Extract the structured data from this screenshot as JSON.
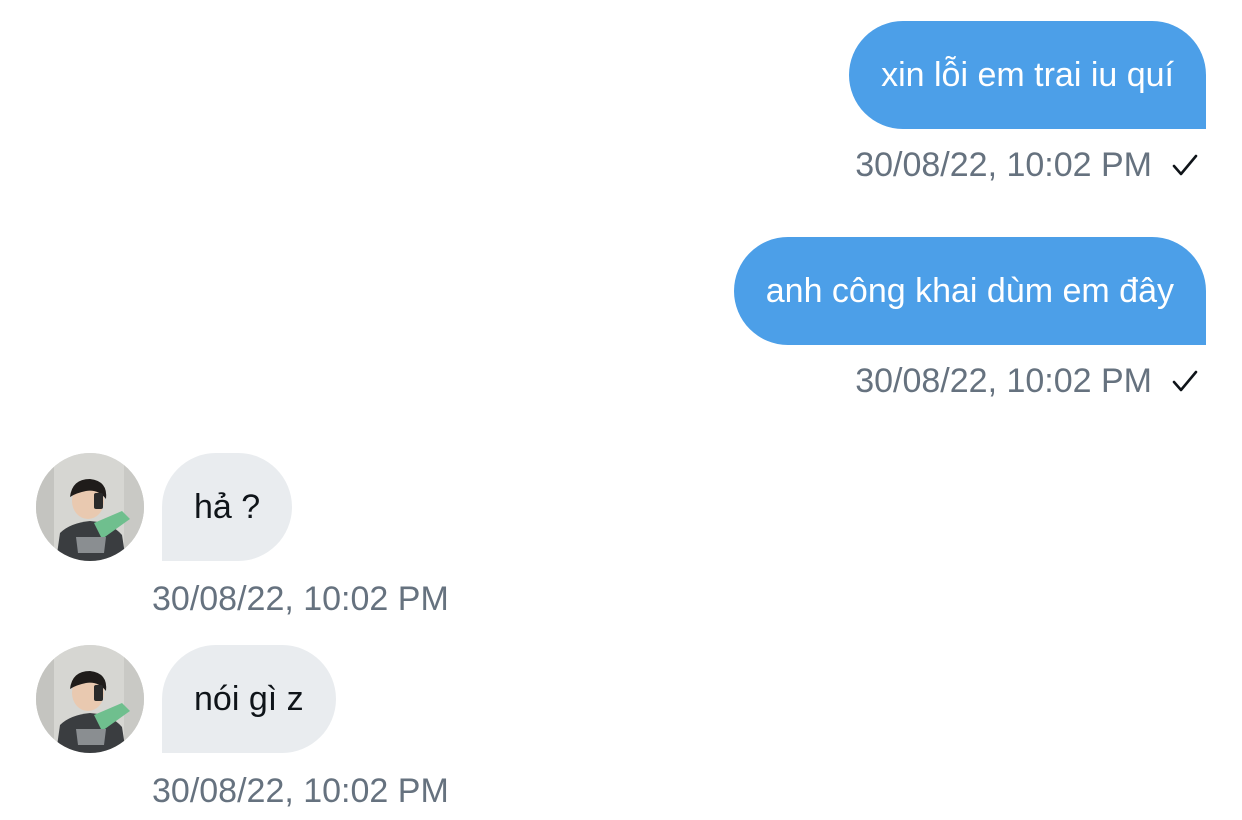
{
  "messages": [
    {
      "direction": "sent",
      "text": "xin lỗi em trai iu quí",
      "timestamp": "30/08/22, 10:02 PM",
      "status_icon": "check-icon"
    },
    {
      "direction": "sent",
      "text": "anh công khai dùm em đây",
      "timestamp": "30/08/22, 10:02 PM",
      "status_icon": "check-icon"
    },
    {
      "direction": "received",
      "text": "hả ?",
      "timestamp": "30/08/22, 10:02 PM",
      "avatar_icon": "avatar"
    },
    {
      "direction": "received",
      "text": "nói gì z",
      "timestamp": "30/08/22, 10:02 PM",
      "avatar_icon": "avatar"
    }
  ],
  "colors": {
    "sent_bubble": "#4c9fe8",
    "received_bubble": "#e9ecef",
    "timestamp_text": "#66727f",
    "background": "#ffffff"
  }
}
